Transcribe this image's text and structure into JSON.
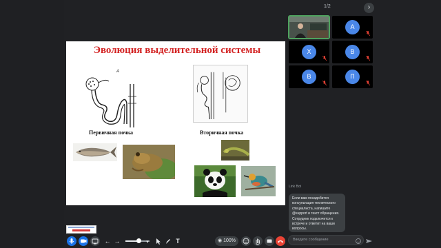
{
  "slide": {
    "title": "Эволюция выделительной системы",
    "caption_primary": "Первичная почка",
    "caption_secondary": "Вторичная почка",
    "diagram_label": "А"
  },
  "pager": {
    "text": "1/2"
  },
  "participants": [
    {
      "initial": ""
    },
    {
      "initial": "А"
    },
    {
      "initial": "Х"
    },
    {
      "initial": "В"
    },
    {
      "initial": "В"
    },
    {
      "initial": "П"
    }
  ],
  "chat": {
    "sender": "Link Bot",
    "message": "Если вам понадобится консультация технического специалиста, напишите @support и текст обращения. Сотрудник подключится к встрече и ответит на ваши вопросы.",
    "placeholder": "Введите сообщение"
  },
  "toolbar": {
    "zoom_label": "100%"
  },
  "colors": {
    "accent_blue": "#1a73e8",
    "avatar_blue": "#4a87e8",
    "active_green": "#4ea35e",
    "title_red": "#d32222",
    "mic_off_red": "#ea4335"
  }
}
